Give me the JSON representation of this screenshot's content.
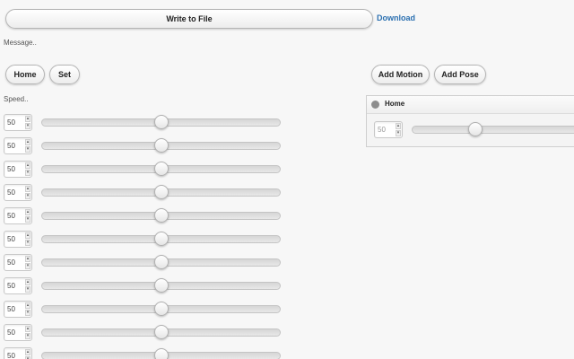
{
  "toolbar": {
    "write_to_file_label": "Write to File",
    "download_label": "Download",
    "message_text": "Message.."
  },
  "controls": {
    "home_label": "Home",
    "set_label": "Set",
    "add_motion_label": "Add Motion",
    "add_pose_label": "Add Pose"
  },
  "speed": {
    "label": "Speed..",
    "min": 0,
    "max": 100
  },
  "sliders": [
    {
      "value": "50"
    },
    {
      "value": "50"
    },
    {
      "value": "50"
    },
    {
      "value": "50"
    },
    {
      "value": "50"
    },
    {
      "value": "50"
    },
    {
      "value": "50"
    },
    {
      "value": "50"
    },
    {
      "value": "50"
    },
    {
      "value": "50"
    },
    {
      "value": "50"
    }
  ],
  "pose": {
    "title": "Home",
    "speed_value": "50"
  },
  "colors": {
    "link": "#2a6fb0",
    "pose_dot": "#8d8d8d"
  }
}
